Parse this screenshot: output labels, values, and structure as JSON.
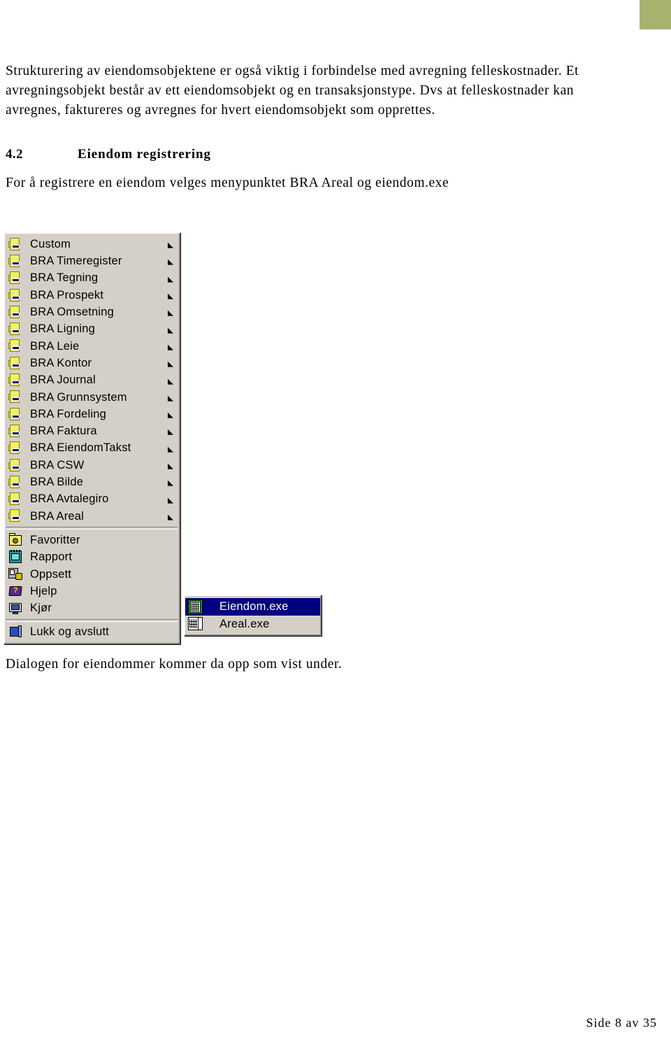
{
  "page": {
    "footer": "Side 8 av 35",
    "accent_color": "#a8b16e"
  },
  "document": {
    "paragraph_1": "Strukturering av eiendomsobjektene er også viktig i forbindelse med avregning felleskostnader. Et avregningsobjekt består av ett eiendomsobjekt og en transaksjonstype. Dvs at felleskostnader kan avregnes, faktureres og avregnes for hvert eiendomsobjekt som opprettes.",
    "heading": {
      "number": "4.2",
      "title": "Eiendom registrering"
    },
    "paragraph_2": "For å registrere en eiendom velges menypunktet BRA Areal og eiendom.exe",
    "paragraph_3": "Dialogen for eiendommer kommer da opp som vist under."
  },
  "menu": {
    "highlight_color": "#000080",
    "face_color": "#d4d0c8",
    "group_modules": [
      {
        "label": "Custom",
        "icon": "bra-folder-icon",
        "has_submenu": true
      },
      {
        "label": "BRA Timeregister",
        "icon": "bra-folder-icon",
        "has_submenu": true
      },
      {
        "label": "BRA Tegning",
        "icon": "bra-folder-icon",
        "has_submenu": true
      },
      {
        "label": "BRA Prospekt",
        "icon": "bra-folder-icon",
        "has_submenu": true
      },
      {
        "label": "BRA Omsetning",
        "icon": "bra-folder-icon",
        "has_submenu": true
      },
      {
        "label": "BRA Ligning",
        "icon": "bra-folder-icon",
        "has_submenu": true
      },
      {
        "label": "BRA Leie",
        "icon": "bra-folder-icon",
        "has_submenu": true
      },
      {
        "label": "BRA Kontor",
        "icon": "bra-folder-icon",
        "has_submenu": true
      },
      {
        "label": "BRA Journal",
        "icon": "bra-folder-icon",
        "has_submenu": true
      },
      {
        "label": "BRA Grunnsystem",
        "icon": "bra-folder-icon",
        "has_submenu": true
      },
      {
        "label": "BRA Fordeling",
        "icon": "bra-folder-icon",
        "has_submenu": true
      },
      {
        "label": "BRA Faktura",
        "icon": "bra-folder-icon",
        "has_submenu": true
      },
      {
        "label": "BRA EiendomTakst",
        "icon": "bra-folder-icon",
        "has_submenu": true
      },
      {
        "label": "BRA CSW",
        "icon": "bra-folder-icon",
        "has_submenu": true
      },
      {
        "label": "BRA Bilde",
        "icon": "bra-folder-icon",
        "has_submenu": true
      },
      {
        "label": "BRA Avtalegiro",
        "icon": "bra-folder-icon",
        "has_submenu": true
      },
      {
        "label": "BRA Areal",
        "icon": "bra-folder-icon",
        "has_submenu": true
      }
    ],
    "group_tools": [
      {
        "label": "Favoritter",
        "icon": "favorites-folder-icon"
      },
      {
        "label": "Rapport",
        "icon": "report-notebook-icon"
      },
      {
        "label": "Oppsett",
        "icon": "settings-computer-icon"
      },
      {
        "label": "Hjelp",
        "icon": "help-book-icon"
      },
      {
        "label": "Kjør",
        "icon": "run-monitor-icon"
      }
    ],
    "group_exit": [
      {
        "label": "Lukk og avslutt",
        "icon": "close-cube-icon"
      }
    ]
  },
  "submenu": {
    "items": [
      {
        "label": "Eiendom.exe",
        "icon": "building-icon",
        "selected": true
      },
      {
        "label": "Areal.exe",
        "icon": "grid-sheet-icon",
        "selected": false
      }
    ]
  }
}
